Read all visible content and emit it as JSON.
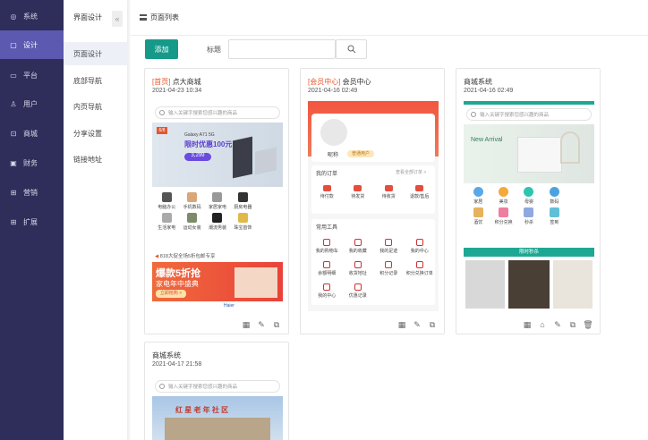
{
  "sidebar": {
    "items": [
      {
        "label": "系统",
        "icon": "gear-icon",
        "glyph": "◎"
      },
      {
        "label": "设计",
        "icon": "design-icon",
        "glyph": "▢"
      },
      {
        "label": "平台",
        "icon": "monitor-icon",
        "glyph": "▭"
      },
      {
        "label": "用户",
        "icon": "user-icon",
        "glyph": "♙"
      },
      {
        "label": "商城",
        "icon": "shop-icon",
        "glyph": "⊡"
      },
      {
        "label": "财务",
        "icon": "finance-icon",
        "glyph": "▣"
      },
      {
        "label": "营销",
        "icon": "gift-icon",
        "glyph": "⊞"
      },
      {
        "label": "扩展",
        "icon": "extend-icon",
        "glyph": "⊞"
      }
    ]
  },
  "submenu": {
    "title": "界面设计",
    "collapse": "«",
    "items": [
      "页面设计",
      "底部导航",
      "内页导航",
      "分享设置",
      "链接地址"
    ]
  },
  "main": {
    "title": "页面列表",
    "add_label": "添加",
    "filter_label": "标题",
    "search_placeholder": ""
  },
  "cards": [
    {
      "tag": "[首页]",
      "name": " 点大商城",
      "date": "2021-04-23 10:34"
    },
    {
      "tag": "[会员中心]",
      "name": " 会员中心",
      "date": "2021-04-16 02:49"
    },
    {
      "tag": "",
      "name": "商城系统",
      "date": "2021-04-16 02:49"
    },
    {
      "tag": "",
      "name": "商城系统",
      "date": "2021-04-17 21:58"
    }
  ],
  "phone": {
    "search_hint": "输入关键字搜索您感兴趣的商品",
    "p1": {
      "banner_brand": "Galaxy A71 5G",
      "banner_text": "限时优惠100元",
      "banner_price": "3,299",
      "icons": [
        "电脑办公",
        "手机数码",
        "家居家电",
        "厨房电器",
        "",
        "生活家电",
        "运动女装",
        "潮流男装",
        "珠宝首饰",
        ""
      ],
      "notice": "818大促全场5折包邮专享",
      "promo_title": "爆款5折抢",
      "promo_sub": "家电年中盛典",
      "promo_btn": "立即抢购 >",
      "brand": "Haier"
    },
    "p2": {
      "nickname": "昵称",
      "level": "普通用户",
      "orders_title": "我的订单",
      "orders_link": "查看全部订单 >",
      "orders": [
        "待付款",
        "待发货",
        "待收货",
        "退款/售后"
      ],
      "tools_title": "常用工具",
      "tools": [
        "我的购物车",
        "我的收藏",
        "我的足迹",
        "我的中心",
        "余额明细",
        "收货地址",
        "积分记录",
        "积分兑换订单",
        "我的中心",
        "优惠记录"
      ]
    },
    "p3": {
      "banner_brand": "New Arrival",
      "icons": [
        "家居",
        "美妆",
        "母婴",
        "数码",
        "",
        "酒饮",
        "积分兑换",
        "秒杀",
        "签到",
        ""
      ],
      "section": "限时秒杀"
    },
    "p4": {
      "banner_text": "红 星 老 年 社 区"
    }
  },
  "colors": {
    "sidebar_bg": "#2f2d5a",
    "sidebar_active": "#5b59b0",
    "accent": "#159a8a",
    "red": "#e4572e"
  }
}
